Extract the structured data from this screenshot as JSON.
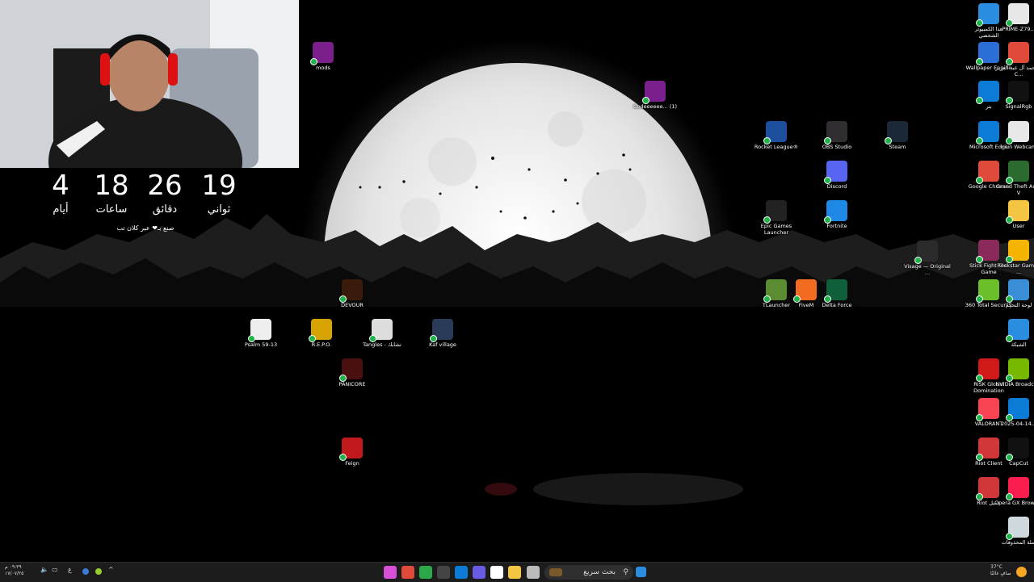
{
  "countdown": {
    "units": [
      {
        "value": "19",
        "label": "ثواني"
      },
      {
        "value": "26",
        "label": "دقائق"
      },
      {
        "value": "18",
        "label": "ساعات"
      },
      {
        "value": "4",
        "label": "أيام"
      }
    ],
    "credit": "صنع بـ❤ عبر كلان تب"
  },
  "desktop_icons": [
    {
      "label": "mods",
      "icon": "winrar-icon",
      "color": "#7a1f8c"
    },
    {
      "label": "Codeeeeee... (1)",
      "icon": "winrar-icon",
      "color": "#7a1f8c"
    },
    {
      "label": "Rocket League®",
      "icon": "rocket-league-icon",
      "color": "#1d4f9c"
    },
    {
      "label": "OBS Studio",
      "icon": "obs-icon",
      "color": "#302e31"
    },
    {
      "label": "Steam",
      "icon": "steam-icon",
      "color": "#1b2838"
    },
    {
      "label": "Discord",
      "icon": "discord-icon",
      "color": "#5865f2"
    },
    {
      "label": "Epic Games Launcher",
      "icon": "epic-games-icon",
      "color": "#222222"
    },
    {
      "label": "Fortnite",
      "icon": "fortnite-icon",
      "color": "#1e88e5"
    },
    {
      "label": "TLauncher",
      "icon": "minecraft-icon",
      "color": "#5b8c32"
    },
    {
      "label": "FiveM",
      "icon": "fivem-icon",
      "color": "#f26b21"
    },
    {
      "label": "Delta Force",
      "icon": "delta-force-icon",
      "color": "#0f5f3a"
    },
    {
      "label": "Visage — Original ...",
      "icon": "music-file-icon",
      "color": "#2b2b2b"
    },
    {
      "label": "DEVOUR",
      "icon": "devour-icon",
      "color": "#3a1a0a"
    },
    {
      "label": "Psalm 59-13",
      "icon": "psalm-icon",
      "color": "#eeeeee"
    },
    {
      "label": "R.E.P.O.",
      "icon": "repo-icon",
      "color": "#d7a300"
    },
    {
      "label": "Tangles - تشابك",
      "icon": "tangles-icon",
      "color": "#dddddd"
    },
    {
      "label": "Kaf village",
      "icon": "kaf-village-icon",
      "color": "#2a3b5a"
    },
    {
      "label": "PANICORE",
      "icon": "panicore-icon",
      "color": "#4a1010"
    },
    {
      "label": "Feign",
      "icon": "feign-icon",
      "color": "#c0181c"
    },
    {
      "label": "هذا الكمبيوتر الشخصي",
      "icon": "this-pc-icon",
      "color": "#2a8de0"
    },
    {
      "label": "PRIME-Z79...",
      "icon": "document-icon",
      "color": "#e6e6e6"
    },
    {
      "label": "Wallpaper Engine",
      "icon": "wallpaper-engine-icon",
      "color": "#2b6fd6"
    },
    {
      "label": "محمد آل عبد العزيز - C...",
      "icon": "chrome-icon",
      "color": "#e04a3a"
    },
    {
      "label": "بتر",
      "icon": "edge-icon",
      "color": "#0c7bd6"
    },
    {
      "label": "SignalRgb",
      "icon": "signalrgb-icon",
      "color": "#111111"
    },
    {
      "label": "Microsoft Edge",
      "icon": "edge-icon",
      "color": "#0c7bd6"
    },
    {
      "label": "Iriun Webcam",
      "icon": "webcam-icon",
      "color": "#e8e8e8"
    },
    {
      "label": "Google Chrome",
      "icon": "chrome-icon",
      "color": "#e04a3a"
    },
    {
      "label": "Grand Theft Auto V",
      "icon": "gta-icon",
      "color": "#2c6b2f"
    },
    {
      "label": "User",
      "icon": "folder-icon",
      "color": "#f4c542"
    },
    {
      "label": "Stick Fight The Game",
      "icon": "stick-fight-icon",
      "color": "#8a2a5a"
    },
    {
      "label": "Rockstar Games ...",
      "icon": "rockstar-icon",
      "color": "#f4b400"
    },
    {
      "label": "360 Total Security",
      "icon": "security-icon",
      "color": "#6abf2a"
    },
    {
      "label": "لوحة التحكم",
      "icon": "control-panel-icon",
      "color": "#3a8ed6"
    },
    {
      "label": "الشبكة",
      "icon": "network-icon",
      "color": "#2a8de0"
    },
    {
      "label": "RISK Global Domination",
      "icon": "risk-icon",
      "color": "#d01a1a"
    },
    {
      "label": "NVIDIA Broadcast",
      "icon": "nvidia-icon",
      "color": "#76b900"
    },
    {
      "label": "VALORANT",
      "icon": "valorant-icon",
      "color": "#fa4454"
    },
    {
      "label": "2025-04-14...",
      "icon": "edge-icon",
      "color": "#0c7bd6"
    },
    {
      "label": "Riot Client",
      "icon": "riot-icon",
      "color": "#d13639"
    },
    {
      "label": "CapCut",
      "icon": "capcut-icon",
      "color": "#111111"
    },
    {
      "label": "Riot عميل",
      "icon": "riot-icon",
      "color": "#d13639"
    },
    {
      "label": "Opera GX Browser",
      "icon": "opera-gx-icon",
      "color": "#fa1e4e"
    },
    {
      "label": "سلة المحذوفات",
      "icon": "recycle-bin-icon",
      "color": "#cfd8dc"
    }
  ],
  "taskbar": {
    "search_placeholder": "بحث سريع",
    "apps": [
      {
        "icon": "app-icon",
        "color": "#d64fd6"
      },
      {
        "icon": "chrome-icon",
        "color": "#e04a3a"
      },
      {
        "icon": "media-player-icon",
        "color": "#2aa84a"
      },
      {
        "icon": "steam-icon",
        "color": "#444444"
      },
      {
        "icon": "edge-icon",
        "color": "#0c7bd6"
      },
      {
        "icon": "media-icon",
        "color": "#6a5be6"
      },
      {
        "icon": "store-icon",
        "color": "#ffffff"
      },
      {
        "icon": "file-explorer-icon",
        "color": "#f4c542"
      },
      {
        "icon": "task-view-icon",
        "color": "#bbbbbb"
      }
    ],
    "weather_temp": "37°C",
    "weather_desc": "صافٍ غالبًا",
    "clock_time": "٠٩:٣٩ م",
    "clock_date": "١٧/٠٧/٢٥",
    "language": "ع"
  }
}
